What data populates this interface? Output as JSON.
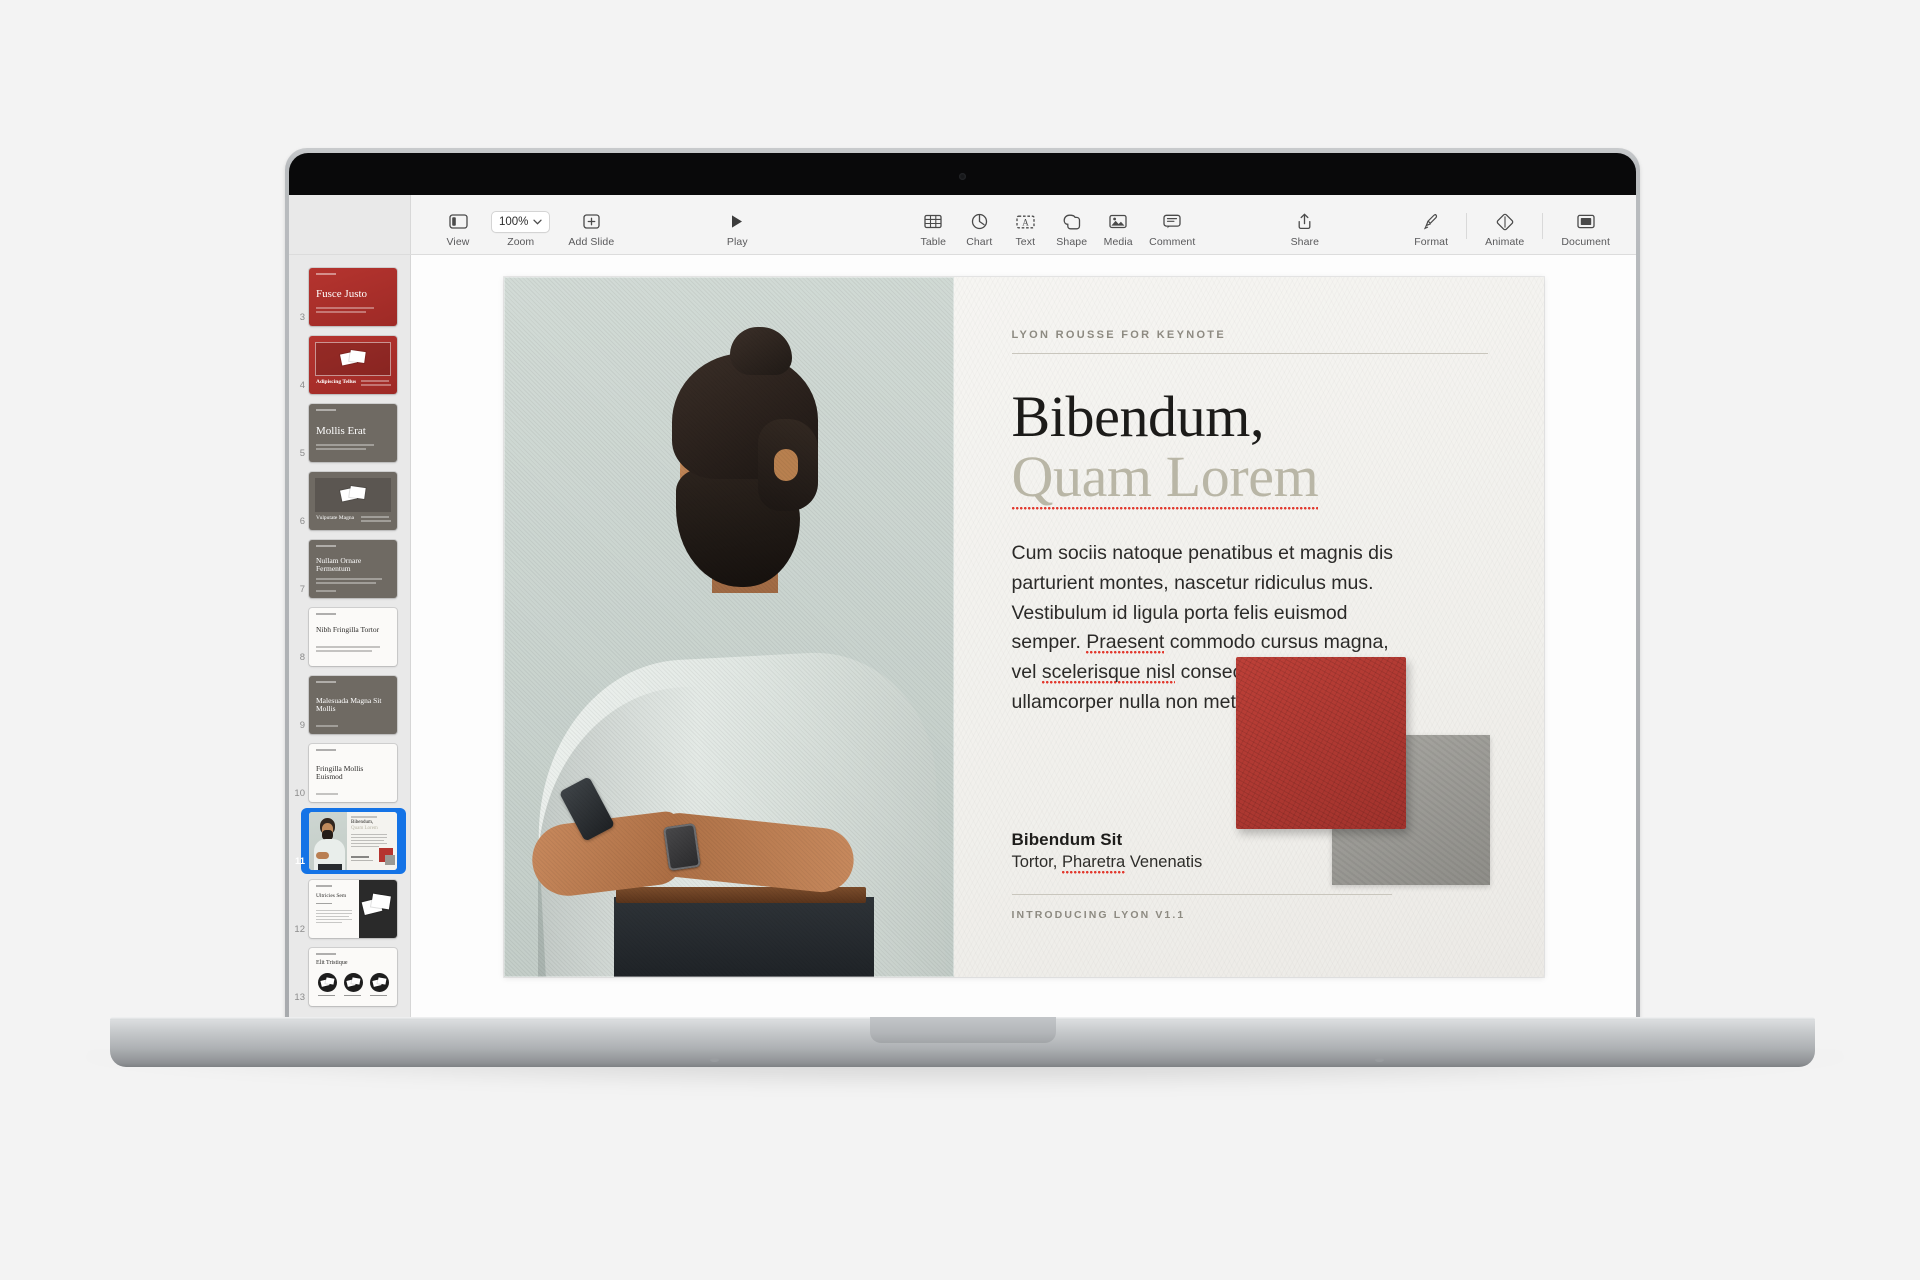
{
  "app": {
    "name": "Keynote",
    "toolbar": {
      "view_label": "View",
      "zoom_label": "Zoom",
      "zoom_value": "100%",
      "add_slide_label": "Add Slide",
      "play_label": "Play",
      "table_label": "Table",
      "chart_label": "Chart",
      "text_label": "Text",
      "shape_label": "Shape",
      "media_label": "Media",
      "comment_label": "Comment",
      "share_label": "Share",
      "format_label": "Format",
      "animate_label": "Animate",
      "document_label": "Document"
    }
  },
  "navigator": {
    "slides": [
      {
        "number": "3",
        "title": "Fusce Justo",
        "style": "red-title",
        "selected": false
      },
      {
        "number": "4",
        "title": "Adipiscing Tellus",
        "style": "red-photo",
        "selected": false
      },
      {
        "number": "5",
        "title": "Mollis Erat",
        "style": "gray-title",
        "selected": false
      },
      {
        "number": "6",
        "title": "Vulputate Magna",
        "style": "gray-photo",
        "selected": false
      },
      {
        "number": "7",
        "title": "Nullam Ornare Fermentum",
        "style": "gray-title2",
        "selected": false
      },
      {
        "number": "8",
        "title": "Nibh Fringilla Tortor",
        "style": "white-title",
        "selected": false
      },
      {
        "number": "9",
        "title": "Malesuada Magna Sit Mollis",
        "style": "gray-title2",
        "selected": false
      },
      {
        "number": "10",
        "title": "Fringilla Mollis Euismod",
        "style": "white-title",
        "selected": false
      },
      {
        "number": "11",
        "title": "Bibendum, Quam Lorem",
        "style": "current",
        "selected": true
      },
      {
        "number": "12",
        "title": "Ultricies Sem",
        "style": "white-dark-photo",
        "selected": false
      },
      {
        "number": "13",
        "title": "Elit Tristique",
        "style": "white-icons",
        "selected": false
      }
    ]
  },
  "slide": {
    "eyebrow": "LYON ROUSSE FOR KEYNOTE",
    "title_line1": "Bibendum,",
    "title_line2": "Quam Lorem",
    "body": "Cum sociis natoque penatibus et magnis dis parturient montes, nascetur ridiculus mus. Vestibulum id ligula porta felis euismod semper. Praesent commodo cursus magna, vel scelerisque nisl consectetur et. Donec ullamcorper nulla non metus auctor fringilla.",
    "body_parts": {
      "p1": "Cum sociis natoque penatibus et magnis dis parturient montes, nascetur ridiculus mus. Vestibulum id ligula porta felis euismod semper. ",
      "m1": "Praesent",
      "p2": " commodo cursus magna, vel ",
      "m2": "scelerisque nisl",
      "p3": " consectetur et. Donec ullamcorper nulla non metus auctor fringilla."
    },
    "footer_title": "Bibendum Sit",
    "footer_sub_pre": "Tortor, ",
    "footer_sub_mis": "Pharetra",
    "footer_sub_post": " Venenatis",
    "footer_note": "INTRODUCING LYON V1.1",
    "colors": {
      "accent_red": "#b5342f",
      "swatch_gray": "#9a9994",
      "title_muted": "#b9b6a6",
      "selection_blue": "#1473e6",
      "spellcheck_red": "#e2392e"
    }
  }
}
